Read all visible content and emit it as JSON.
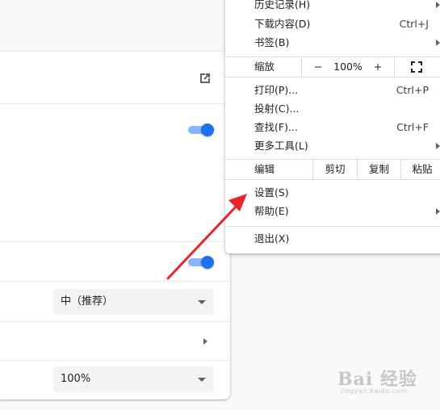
{
  "settings": {
    "select_font_size": "中（推荐）",
    "select_zoom": "100%",
    "toggle_1_on": true,
    "toggle_2_on": true
  },
  "menu": {
    "items_top": [
      {
        "label": "历史记录(H)",
        "shortcut": "",
        "submenu": true
      },
      {
        "label": "下载内容(D)",
        "shortcut": "Ctrl+J",
        "submenu": false
      },
      {
        "label": "书签(B)",
        "shortcut": "",
        "submenu": true
      }
    ],
    "zoom": {
      "label": "缩放",
      "minus": "−",
      "value": "100%",
      "plus": "+",
      "fullscreen_icon": "fullscreen-icon"
    },
    "items_mid": [
      {
        "label": "打印(P)...",
        "shortcut": "Ctrl+P",
        "submenu": false
      },
      {
        "label": "投射(C)...",
        "shortcut": "",
        "submenu": false
      },
      {
        "label": "查找(F)...",
        "shortcut": "Ctrl+F",
        "submenu": false
      },
      {
        "label": "更多工具(L)",
        "shortcut": "",
        "submenu": true
      }
    ],
    "edit": {
      "label": "编辑",
      "cut": "剪切",
      "copy": "复制",
      "paste": "粘贴"
    },
    "items_bottom": [
      {
        "label": "设置(S)",
        "shortcut": "",
        "submenu": false
      },
      {
        "label": "帮助(E)",
        "shortcut": "",
        "submenu": true
      }
    ],
    "exit": {
      "label": "退出(X)"
    }
  },
  "annotation": {
    "arrow_color": "#e8262a"
  },
  "watermark": {
    "main": "Bai 经验",
    "sub": "jingyan.baidu.com"
  },
  "colors": {
    "accent": "#1a73e8",
    "accent_light": "#8ab4f8"
  }
}
